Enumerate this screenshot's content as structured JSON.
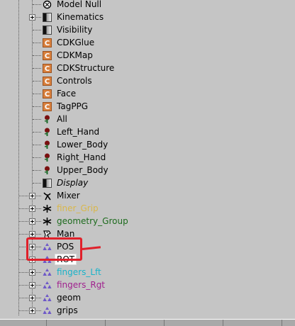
{
  "tree": {
    "items": [
      {
        "label": "Model Null",
        "icon": "null-icon",
        "color": "#000000",
        "italic": false,
        "expandable": false,
        "level": 1
      },
      {
        "label": "Kinematics",
        "icon": "kinematics-icon",
        "color": "#000000",
        "italic": false,
        "expandable": true,
        "level": 1
      },
      {
        "label": "Visibility",
        "icon": "visibility-icon",
        "color": "#000000",
        "italic": false,
        "expandable": false,
        "level": 1
      },
      {
        "label": "CDKGlue",
        "icon": "custom-property-icon",
        "color": "#000000",
        "italic": false,
        "expandable": false,
        "level": 1
      },
      {
        "label": "CDKMap",
        "icon": "custom-property-icon",
        "color": "#000000",
        "italic": false,
        "expandable": false,
        "level": 1
      },
      {
        "label": "CDKStructure",
        "icon": "custom-property-icon",
        "color": "#000000",
        "italic": false,
        "expandable": false,
        "level": 1
      },
      {
        "label": "Controls",
        "icon": "custom-property-icon",
        "color": "#000000",
        "italic": false,
        "expandable": false,
        "level": 1
      },
      {
        "label": "Face",
        "icon": "custom-property-icon",
        "color": "#000000",
        "italic": false,
        "expandable": false,
        "level": 1
      },
      {
        "label": "TagPPG",
        "icon": "custom-property-icon",
        "color": "#000000",
        "italic": false,
        "expandable": false,
        "level": 1
      },
      {
        "label": "All",
        "icon": "keyable-param-icon",
        "color": "#000000",
        "italic": false,
        "expandable": false,
        "level": 1
      },
      {
        "label": "Left_Hand",
        "icon": "keyable-param-icon",
        "color": "#000000",
        "italic": false,
        "expandable": false,
        "level": 1
      },
      {
        "label": "Lower_Body",
        "icon": "keyable-param-icon",
        "color": "#000000",
        "italic": false,
        "expandable": false,
        "level": 1
      },
      {
        "label": "Right_Hand",
        "icon": "keyable-param-icon",
        "color": "#000000",
        "italic": false,
        "expandable": false,
        "level": 1
      },
      {
        "label": "Upper_Body",
        "icon": "keyable-param-icon",
        "color": "#000000",
        "italic": false,
        "expandable": false,
        "level": 1
      },
      {
        "label": "Display",
        "icon": "display-icon",
        "color": "#000000",
        "italic": true,
        "expandable": false,
        "level": 1
      },
      {
        "label": "Mixer",
        "icon": "mixer-icon",
        "color": "#000000",
        "italic": false,
        "expandable": true,
        "level": 0
      },
      {
        "label": "finer_Grip",
        "icon": "group-icon",
        "color": "#d9b74a",
        "italic": false,
        "expandable": true,
        "level": 0
      },
      {
        "label": "geometry_Group",
        "icon": "group-icon",
        "color": "#1d6b1d",
        "italic": false,
        "expandable": true,
        "level": 0
      },
      {
        "label": "Man",
        "icon": "model-icon",
        "color": "#000000",
        "italic": false,
        "expandable": true,
        "level": 0
      },
      {
        "label": "POS",
        "icon": "null-cluster-icon",
        "color": "#000000",
        "italic": false,
        "expandable": true,
        "level": 0
      },
      {
        "label": "ROT",
        "icon": "null-cluster-icon",
        "color": "#000000",
        "italic": false,
        "expandable": true,
        "level": 0,
        "selected": true
      },
      {
        "label": "fingers_Lft",
        "icon": "null-cluster-icon",
        "color": "#19b3c9",
        "italic": false,
        "expandable": true,
        "level": 0
      },
      {
        "label": "fingers_Rgt",
        "icon": "null-cluster-icon",
        "color": "#a0208e",
        "italic": false,
        "expandable": true,
        "level": 0
      },
      {
        "label": "geom",
        "icon": "null-cluster-icon",
        "color": "#000000",
        "italic": false,
        "expandable": true,
        "level": 0
      },
      {
        "label": "grips",
        "icon": "null-cluster-icon",
        "color": "#000000",
        "italic": false,
        "expandable": true,
        "level": 0
      }
    ]
  },
  "colors": {
    "background": "#c5c5c5",
    "highlight_box": "#e0202a",
    "selected_bg": "#ffffff"
  }
}
